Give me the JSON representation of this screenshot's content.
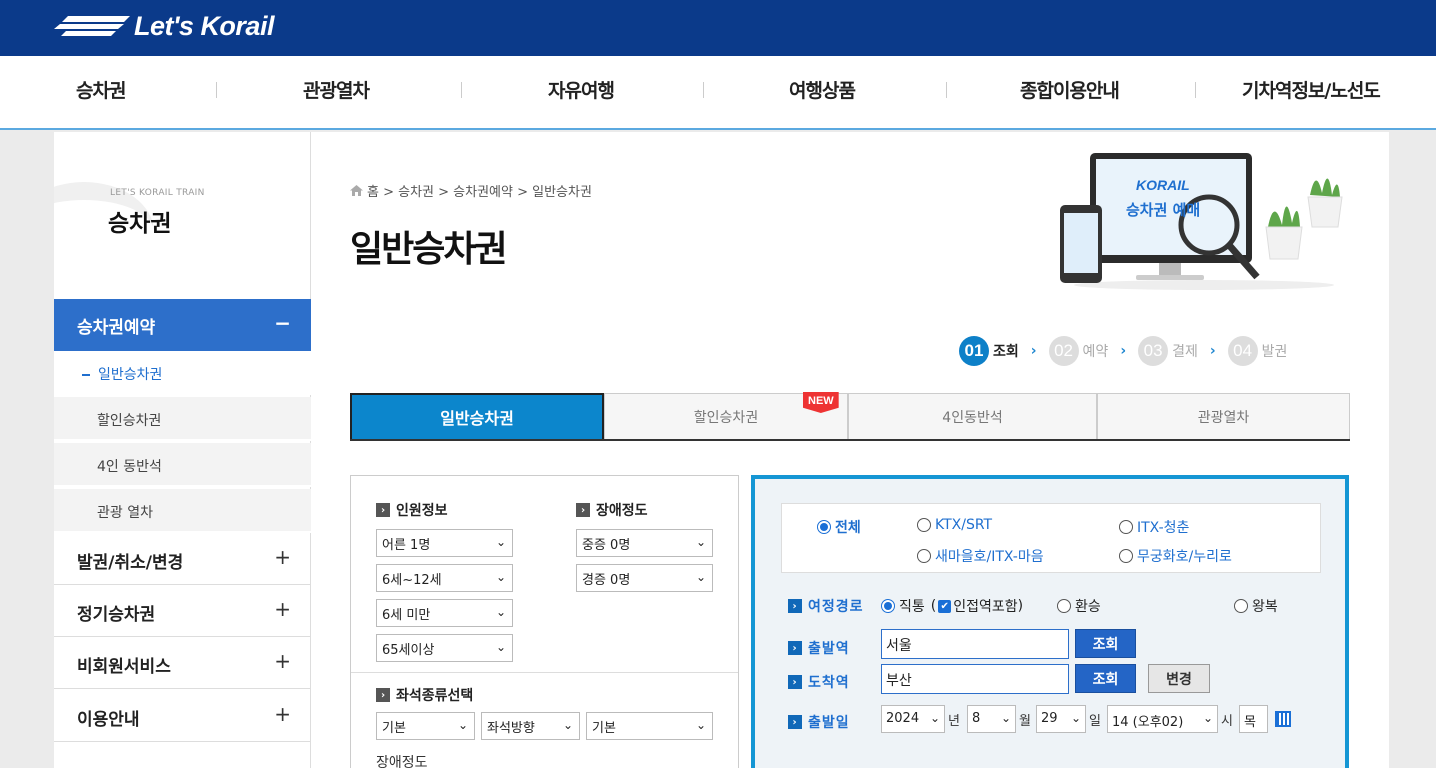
{
  "brand": {
    "name": "Let's Korail"
  },
  "gnb": [
    "승차권",
    "관광열차",
    "자유여행",
    "여행상품",
    "종합이용안내",
    "기차역정보/노선도"
  ],
  "sidebar": {
    "subtitle": "LET'S KORAIL TRAIN",
    "title": "승차권",
    "active_menu": "승차권예약",
    "active_toggle": "−",
    "sub_items": [
      "일반승차권",
      "할인승차권",
      "4인 동반석",
      "관광 열차"
    ],
    "menus": [
      "발권/취소/변경",
      "정기승차권",
      "비회원서비스",
      "이용안내"
    ],
    "menu_toggle": "+"
  },
  "breadcrumb": "홈 > 승차권 > 승차권예약 > 일반승차권",
  "page_title": "일반승차권",
  "illustration": {
    "brand": "KORAIL",
    "caption": "승차권 예매"
  },
  "steps": [
    {
      "num": "01",
      "label": "조회"
    },
    {
      "num": "02",
      "label": "예약"
    },
    {
      "num": "03",
      "label": "결제"
    },
    {
      "num": "04",
      "label": "발권"
    }
  ],
  "tabs": [
    "일반승차권",
    "할인승차권",
    "4인동반석",
    "관광열차"
  ],
  "new_badge": "NEW",
  "passenger": {
    "title": "인원정보",
    "adult": "어른 1명",
    "child": "6세~12세",
    "infant": "6세 미만",
    "senior": "65세이상"
  },
  "disability": {
    "title": "장애정도",
    "severe": "중증 0명",
    "mild": "경증 0명"
  },
  "seat": {
    "title": "좌석종류선택",
    "type": "기본",
    "direction": "좌석방향",
    "extra": "기본",
    "next_label": "장애정도"
  },
  "train_types": [
    "전체",
    "KTX/SRT",
    "ITX-청춘",
    "새마을호/ITX-마음",
    "무궁화호/누리로"
  ],
  "route": {
    "label": "여정경로",
    "direct": "직통",
    "paren_open": "(",
    "nearby": "인접역포함",
    "paren_close": ")",
    "transfer": "환승",
    "round_trip": "왕복"
  },
  "departure": {
    "label": "출발역",
    "value": "서울",
    "search_btn": "조회"
  },
  "arrival": {
    "label": "도착역",
    "value": "부산",
    "search_btn": "조회",
    "swap_btn": "변경"
  },
  "date": {
    "label": "출발일",
    "year": "2024",
    "year_unit": "년",
    "month": "8",
    "month_unit": "월",
    "day": "29",
    "day_unit": "일",
    "hour": "14 (오후02)",
    "hour_unit": "시",
    "weekday": "목"
  },
  "colors": {
    "brand_navy": "#0b3a8a",
    "accent_blue": "#0c86cc",
    "panel_border": "#1596d4"
  }
}
